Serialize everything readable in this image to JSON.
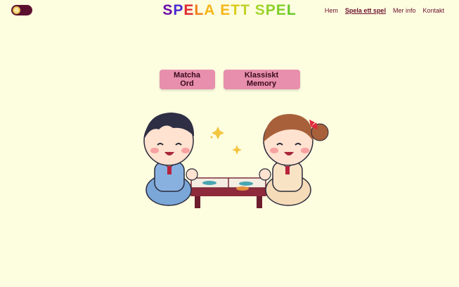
{
  "header": {
    "theme_toggle_icon": "moon-toggle-icon",
    "logo_letters": [
      "S",
      "P",
      "E",
      "L",
      "A",
      " ",
      "E",
      "T",
      "T",
      " ",
      "S",
      "P",
      "E",
      "L"
    ],
    "logo_colors": [
      "#6a0dad",
      "#4b2bd1",
      "#e0292a",
      "#f07e18",
      "#f5b619",
      "#ffffff",
      "#f5b619",
      "#d9cc1a",
      "#c2d128",
      "#ffffff",
      "#a7d62e",
      "#8fd12b",
      "#7fce2a",
      "#68c92a"
    ]
  },
  "nav": {
    "items": [
      "Hem",
      "Spela ett spel",
      "Mer info",
      "Kontakt"
    ],
    "active_index": 1
  },
  "main": {
    "buttons": [
      "Matcha Ord",
      "Klassiskt Memory"
    ]
  },
  "illustration": {
    "icon": "two-kids-playing-memory-game-image"
  }
}
